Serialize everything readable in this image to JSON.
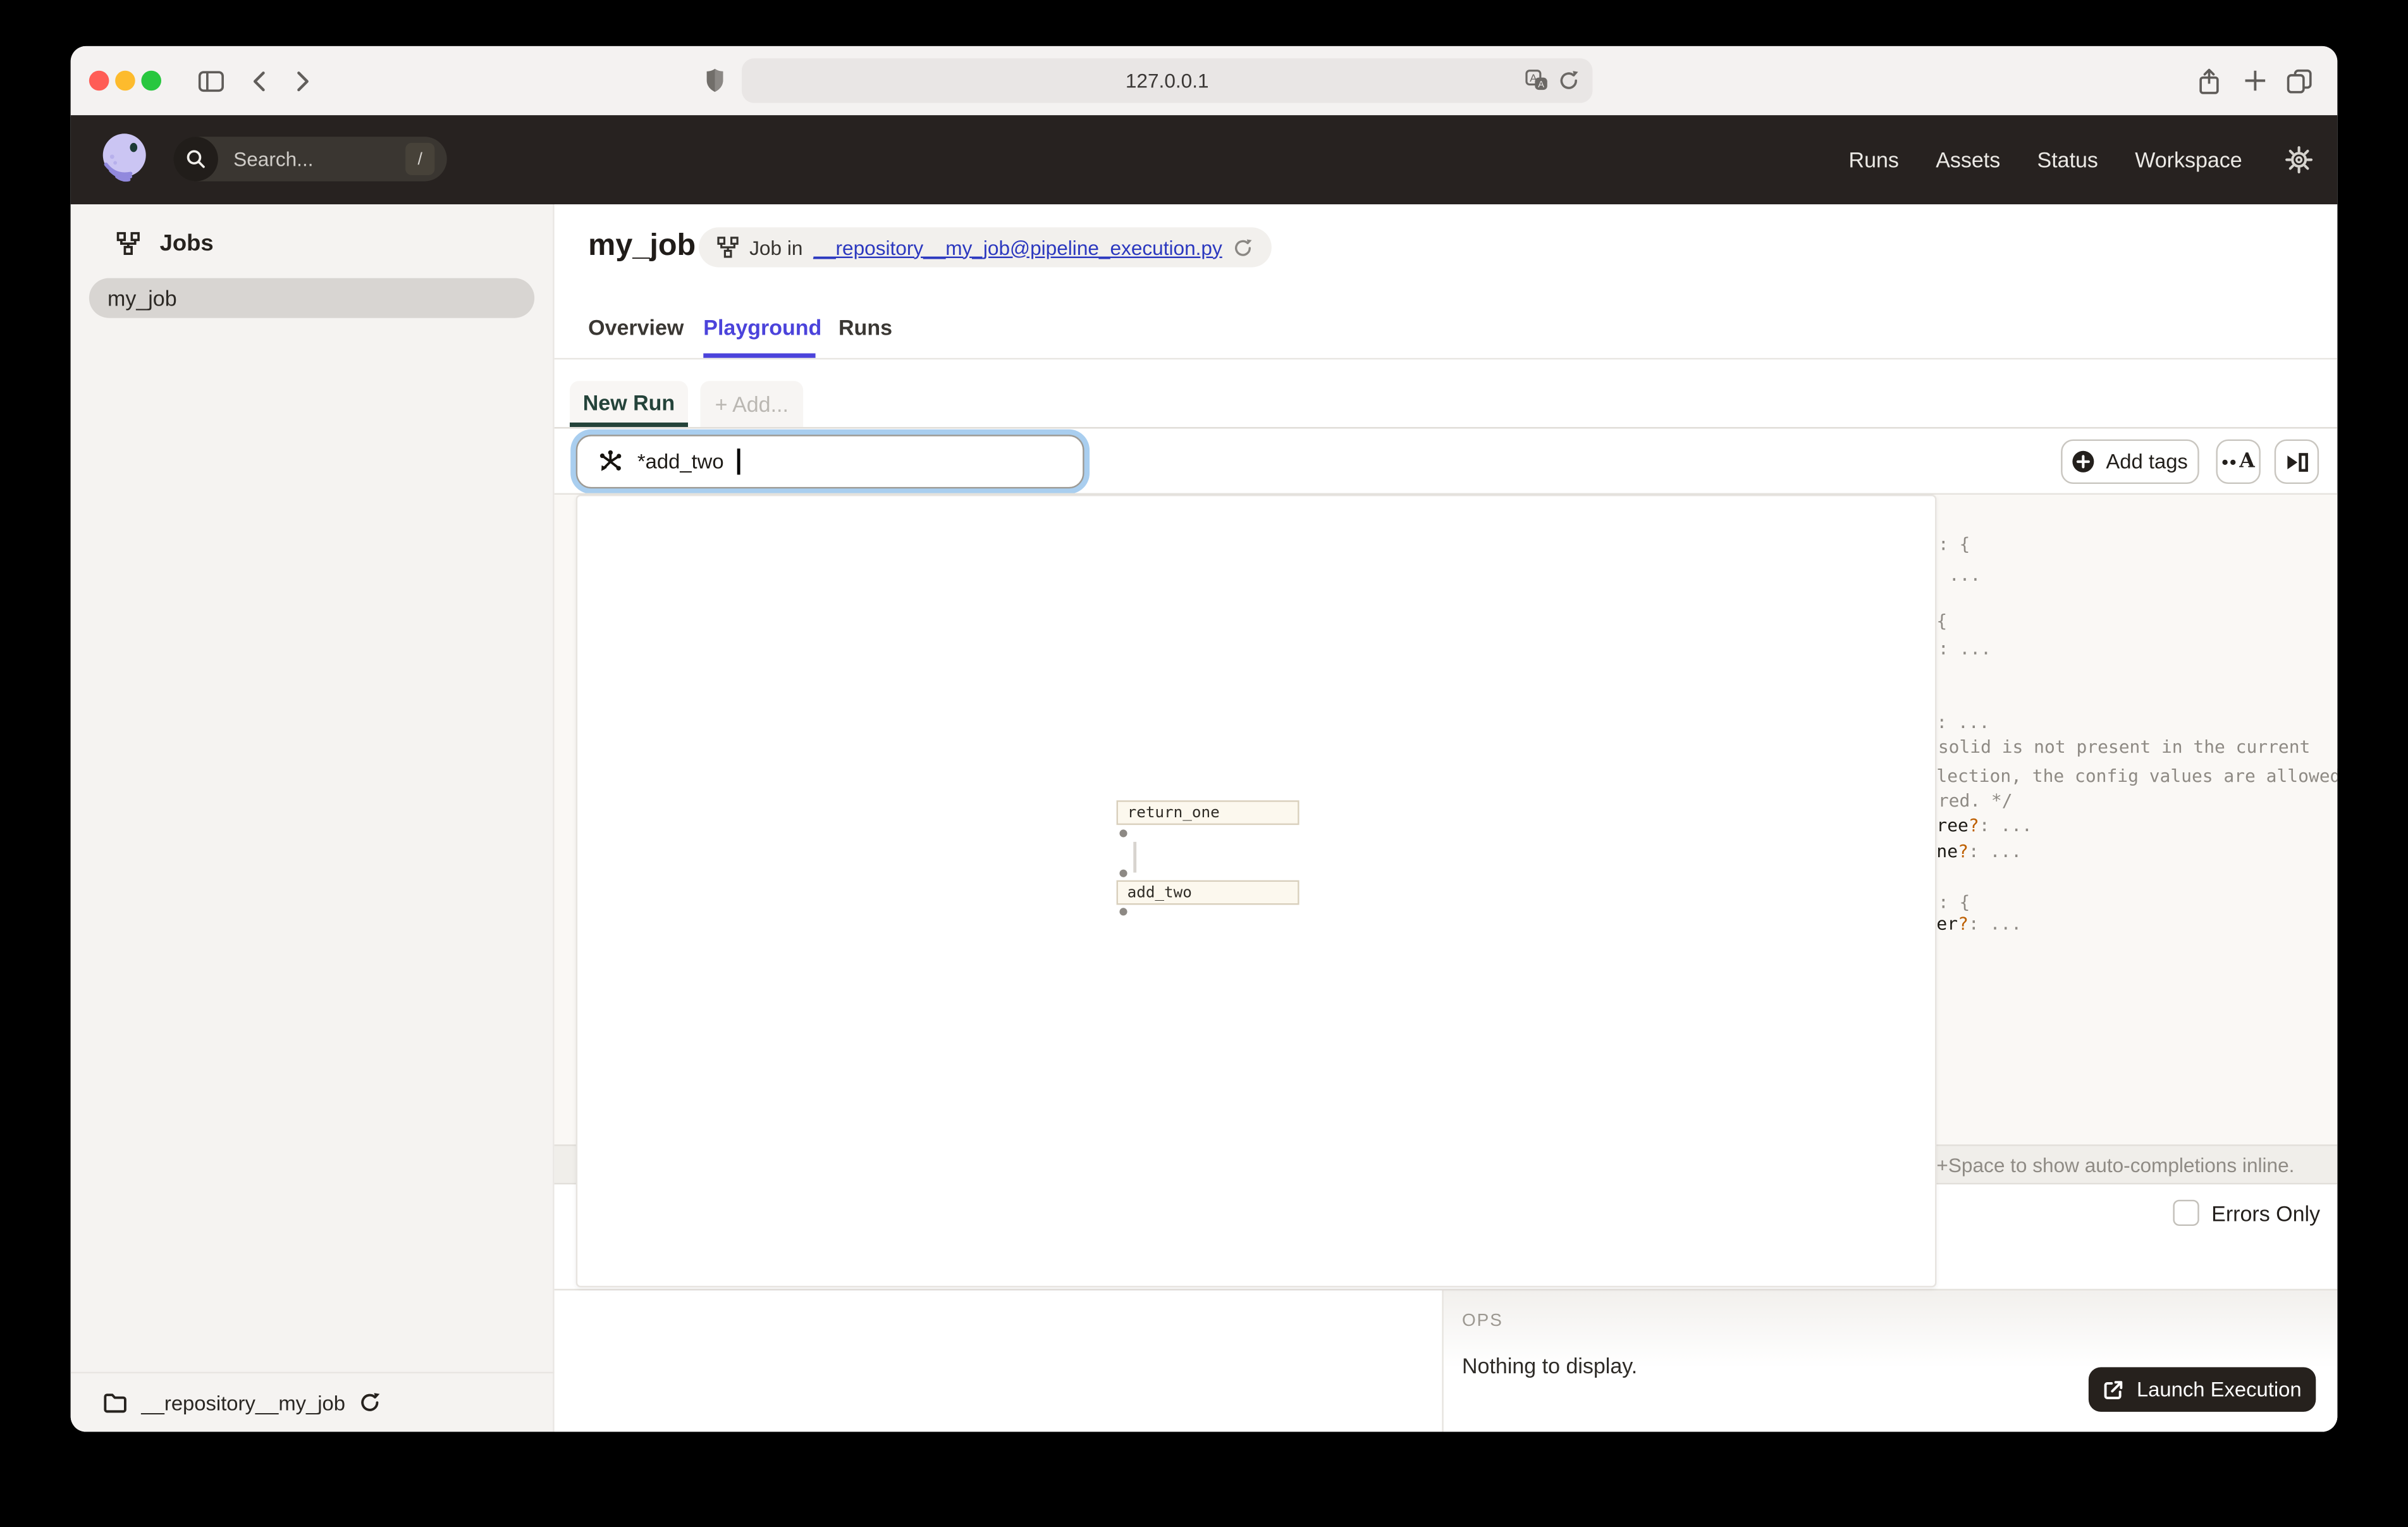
{
  "browser": {
    "url": "127.0.0.1"
  },
  "app_header": {
    "search_placeholder": "Search...",
    "search_shortcut_key": "/",
    "nav_items": [
      "Runs",
      "Assets",
      "Status",
      "Workspace"
    ]
  },
  "sidebar": {
    "section_title": "Jobs",
    "job_item": "my_job",
    "repo_footer": "__repository__my_job"
  },
  "page": {
    "title": "my_job",
    "job_pill_prefix": "Job in",
    "job_pill_link": "__repository__my_job@pipeline_execution.py",
    "tabs": [
      "Overview",
      "Playground",
      "Runs"
    ],
    "active_tab": "Playground"
  },
  "run_config": {
    "new_run_tab": "New Run",
    "add_tab": "+ Add...",
    "op_selector_value": "*add_two",
    "add_tags_button": "Add tags",
    "hint_bar": "+Space to show auto-completions inline.",
    "errors_only_label": "Errors Only"
  },
  "graph": {
    "nodes": [
      "return_one",
      "add_two"
    ]
  },
  "config_editor": {
    "fragments": [
      {
        "name": "",
        "q": "",
        "rest": ": {"
      },
      {
        "name": "",
        "q": "",
        "rest": "..."
      },
      {
        "name": "",
        "q": "",
        "rest": "{"
      },
      {
        "name": "",
        "q": "",
        "rest": ": ..."
      },
      {
        "name": "",
        "q": "",
        "rest": ": ..."
      },
      {
        "name": "",
        "q": "",
        "rest": "solid is not present in the current"
      },
      {
        "name": "",
        "q": "",
        "rest": "lection, the config values are allowed"
      },
      {
        "name": "",
        "q": "",
        "rest": "red. */"
      },
      {
        "name": "ree",
        "q": "?",
        "rest": ": ..."
      },
      {
        "name": "ne",
        "q": "?",
        "rest": ": ..."
      },
      {
        "name": "",
        "q": "",
        "rest": ": {"
      },
      {
        "name": "er",
        "q": "?",
        "rest": ": ..."
      }
    ]
  },
  "ops_panel": {
    "title": "OPS",
    "empty_message": "Nothing to display."
  },
  "launch": {
    "button_label": "Launch Execution"
  },
  "colors": {
    "accent_blue": "#4b43db",
    "link_blue": "#2b38bf",
    "focus_ring": "#a9ceef",
    "header_bg": "#272220",
    "launch_bg": "#26211d",
    "new_run_green": "#24433a",
    "orange_token": "#bd5f00"
  }
}
